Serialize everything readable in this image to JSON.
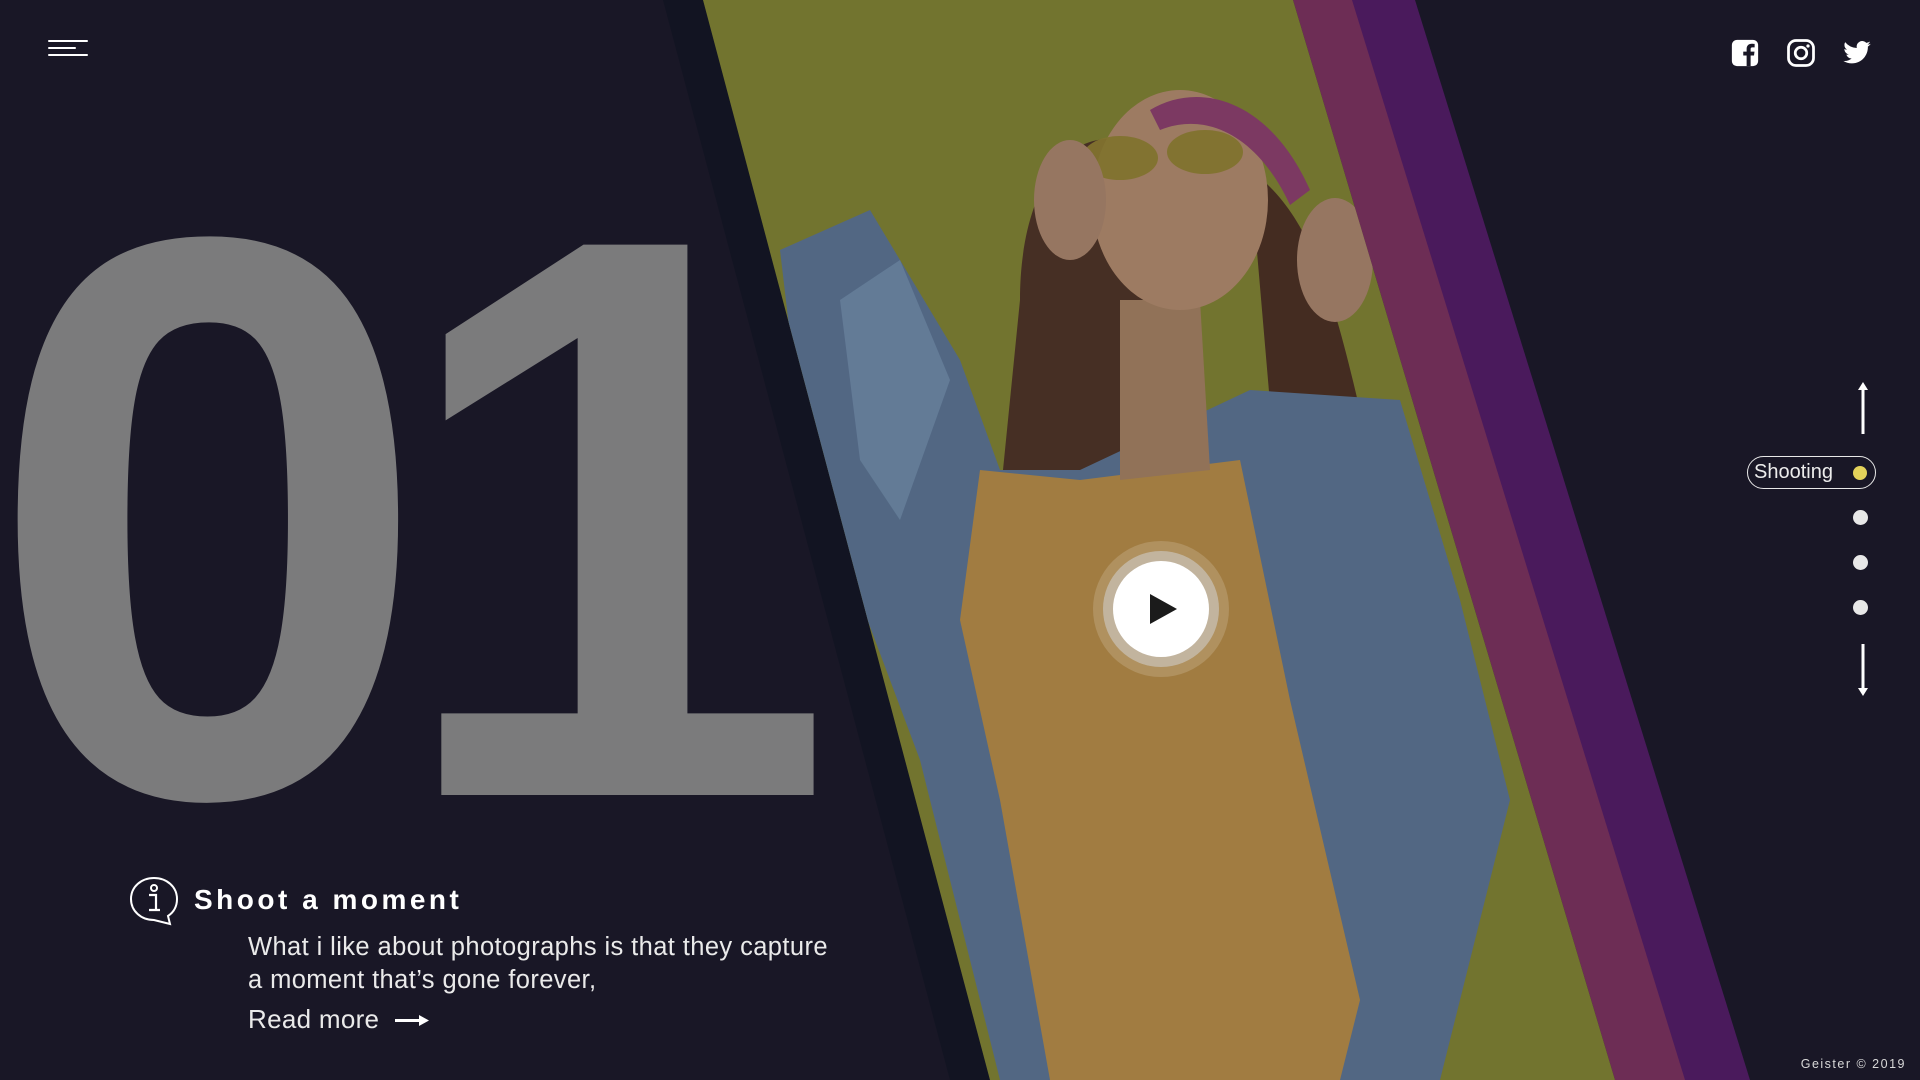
{
  "hero": {
    "number": "01",
    "title": "Shoot a moment",
    "description": "What i like about photographs is that they capture a moment that’s gone forever,",
    "read_more": "Read more"
  },
  "side_nav": {
    "active_label": "Shooting"
  },
  "socials": [
    "facebook-icon",
    "instagram-icon",
    "twitter-icon"
  ],
  "footer": "Geister © 2019",
  "colors": {
    "background": "#191726",
    "accent_dot": "#e3d25a",
    "photo_background": "#c4c624",
    "stripe_red": "#6d2d55",
    "stripe_purple": "#4a1a5c"
  }
}
